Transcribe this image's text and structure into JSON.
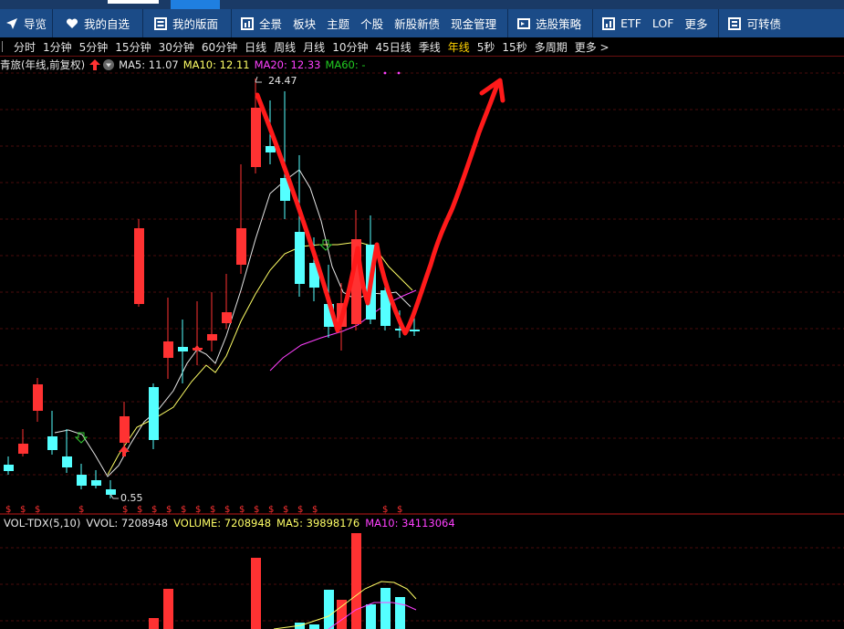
{
  "nav": {
    "items": [
      {
        "label": "导览",
        "icon": "navigate-icon"
      },
      {
        "label": "我的自选",
        "icon": "heart-icon"
      },
      {
        "label": "我的版面",
        "icon": "layout-icon"
      },
      {
        "label": "全景",
        "icon": "panorama-icon"
      },
      {
        "label": "板块"
      },
      {
        "label": "主题"
      },
      {
        "label": "个股"
      },
      {
        "label": "新股新债"
      },
      {
        "label": "现金管理"
      },
      {
        "label": "选股策略",
        "icon": "screener-icon"
      },
      {
        "label": "ETF",
        "icon": "chart-icon"
      },
      {
        "label": "LOF"
      },
      {
        "label": "更多"
      },
      {
        "label": "可转债",
        "icon": "bond-icon"
      }
    ]
  },
  "timeframes": {
    "items": [
      "分时",
      "1分钟",
      "5分钟",
      "15分钟",
      "30分钟",
      "60分钟",
      "日线",
      "周线",
      "月线",
      "10分钟",
      "45日线",
      "季线",
      "年线",
      "5秒",
      "15秒",
      "多周期",
      "更多 >"
    ],
    "active": "年线"
  },
  "price_legend": {
    "title": "青旅(年线,前复权)",
    "ma5": "MA5: 11.07",
    "ma10": "MA10: 12.11",
    "ma20": "MA20: 12.33",
    "ma60": "MA60: -"
  },
  "annotations": {
    "high": "24.47",
    "low": "0.55"
  },
  "volume_legend": {
    "indicator": "VOL-TDX(5,10)",
    "vvol": "VVOL: 7208948",
    "volume": "VOLUME: 7208948",
    "ma5": "MA5: 39898176",
    "ma10": "MA10: 34113064"
  },
  "colors": {
    "up": "#ff3232",
    "down": "#54ffff",
    "ma5": "#e6e6e6",
    "ma10": "#ffff66",
    "ma20": "#ff40ff",
    "ma60": "#22cc22",
    "nav_bg": "#1b4b87",
    "active_tf": "#ffd200"
  }
}
